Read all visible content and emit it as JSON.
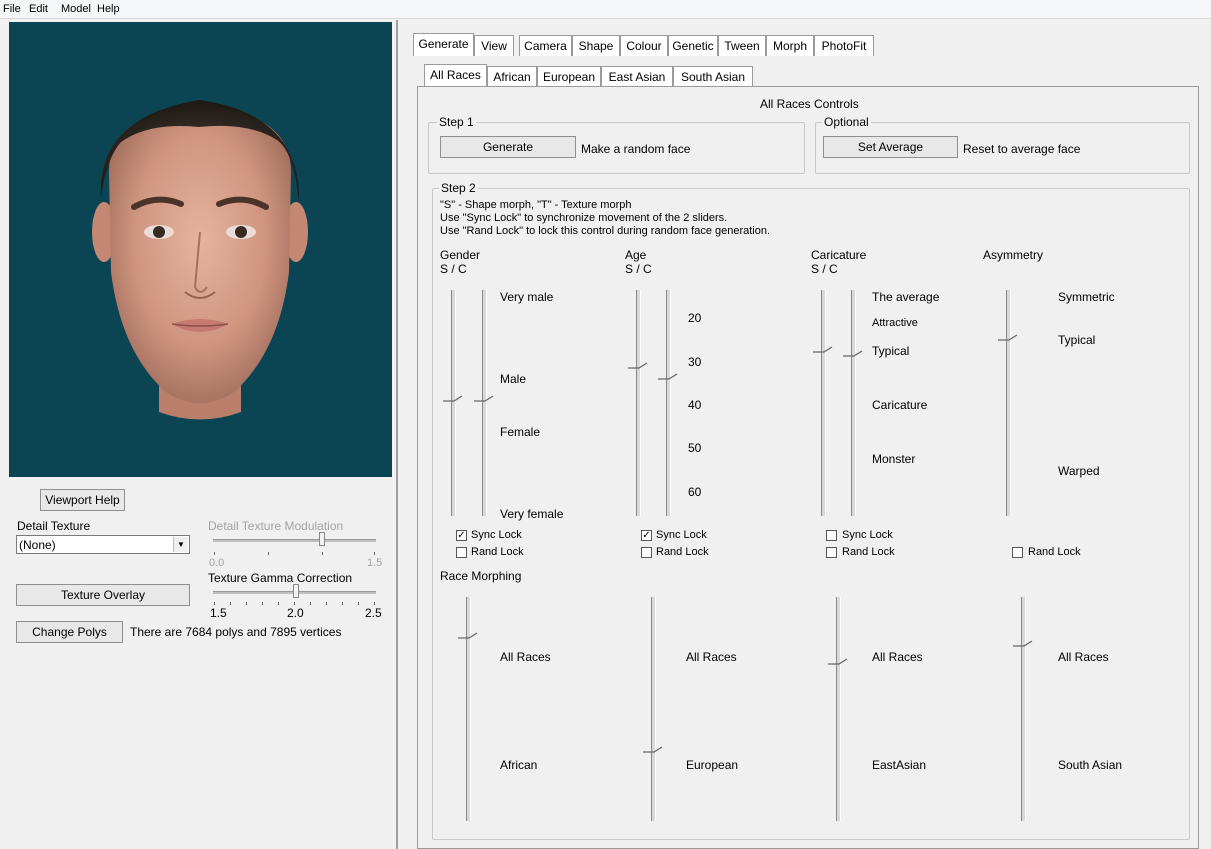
{
  "menu": [
    "File",
    "Edit",
    "Model",
    "Help"
  ],
  "left": {
    "viewport_help": "Viewport Help",
    "detail_texture_label": "Detail Texture",
    "detail_texture_value": "(None)",
    "modulation_label": "Detail Texture Modulation",
    "modulation_min": "0.0",
    "modulation_max": "1.5",
    "texture_overlay": "Texture Overlay",
    "gamma_label": "Texture Gamma Correction",
    "gamma_ticks": [
      "1.5",
      "2.0",
      "2.5"
    ],
    "change_polys": "Change Polys",
    "polys_info": "There are 7684 polys and 7895 vertices"
  },
  "tabs": [
    "Generate",
    "View",
    "Camera",
    "Shape",
    "Colour",
    "Genetic",
    "Tween",
    "Morph",
    "PhotoFit"
  ],
  "subtabs": [
    "All Races",
    "African",
    "European",
    "East Asian",
    "South Asian"
  ],
  "panel_title": "All Races Controls",
  "step1": {
    "title": "Step 1",
    "generate_button": "Generate",
    "generate_desc": "Make a random face"
  },
  "optional": {
    "title": "Optional",
    "set_average_button": "Set Average",
    "set_average_desc": "Reset to average face"
  },
  "step2": {
    "title": "Step 2",
    "instructions": [
      "\"S\" - Shape morph, \"T\" - Texture morph",
      "Use \"Sync Lock\" to synchronize movement of the 2 sliders.",
      "Use \"Rand Lock\" to lock this control during random face generation."
    ],
    "sync_lock": "Sync Lock",
    "rand_lock": "Rand Lock",
    "gender": {
      "title": "Gender",
      "sub": "S / C",
      "labels": [
        "Very male",
        "Male",
        "Female",
        "Very female"
      ],
      "sync": true,
      "rand": false
    },
    "age": {
      "title": "Age",
      "sub": "S / C",
      "labels": [
        "20",
        "30",
        "40",
        "50",
        "60"
      ],
      "sync": true,
      "rand": false
    },
    "caricature": {
      "title": "Caricature",
      "sub": "S / C",
      "labels": [
        "The average",
        "Attractive",
        "Typical",
        "Caricature",
        "Monster"
      ],
      "sync": false,
      "rand": false
    },
    "asymmetry": {
      "title": "Asymmetry",
      "labels": [
        "Symmetric",
        "Typical",
        "Warped"
      ],
      "rand": false
    }
  },
  "race_morphing": {
    "title": "Race Morphing",
    "columns": [
      {
        "top": "All Races",
        "bottom": "African"
      },
      {
        "top": "All Races",
        "bottom": "European"
      },
      {
        "top": "All Races",
        "bottom": "EastAsian"
      },
      {
        "top": "All Races",
        "bottom": "South Asian"
      }
    ]
  }
}
